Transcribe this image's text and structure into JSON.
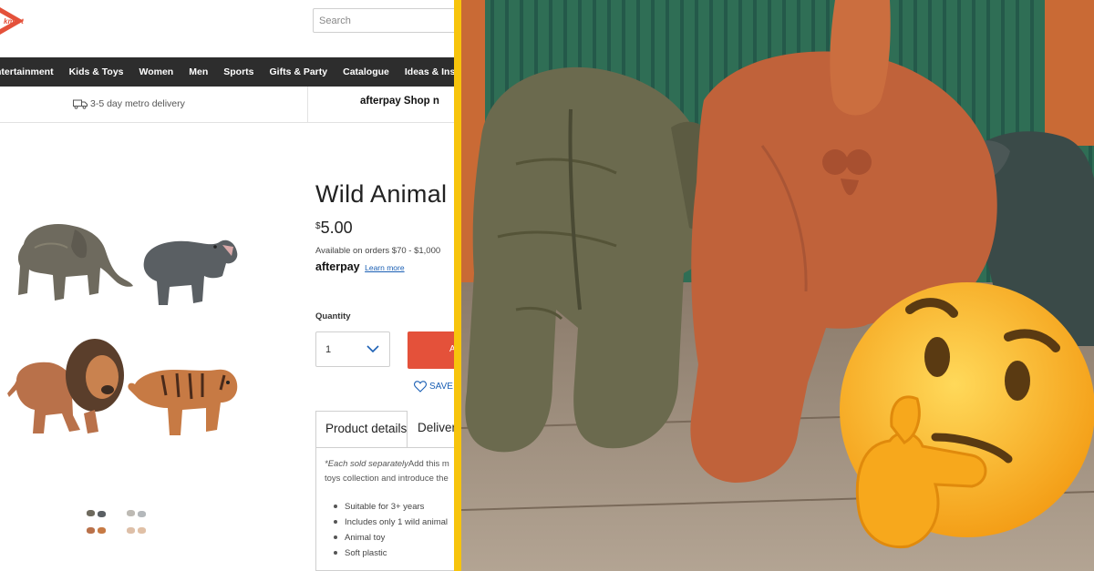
{
  "site": {
    "logo_text": "kmart",
    "search_placeholder": "Search",
    "nav": [
      "Entertainment",
      "Kids & Toys",
      "Women",
      "Men",
      "Sports",
      "Gifts & Party",
      "Catalogue",
      "Ideas & Inspiration"
    ],
    "delivery_label": "3-5 day metro delivery",
    "afterpay_banner": "afterpay Shop n"
  },
  "product": {
    "title": "Wild Animal",
    "price_symbol": "$",
    "price": "5.00",
    "availability": "Available on orders $70 - $1,000",
    "afterpay_brand": "afterpay",
    "afterpay_link": "Learn more",
    "quantity_label": "Quantity",
    "quantity_value": "1",
    "add_button_label": "A",
    "save_label": "SAVE F",
    "tabs": [
      "Product details",
      "Delivery"
    ],
    "description_italic": "*Each sold separately",
    "description_rest": "Add this m",
    "description_line2": "toys collection and introduce the",
    "features": [
      "Suitable for 3+ years",
      "Includes only 1 wild animal",
      "Animal toy",
      "Soft plastic"
    ]
  },
  "gallery": {
    "animals": [
      "elephant",
      "hippo",
      "lion",
      "tiger"
    ]
  },
  "colors": {
    "brand_red": "#e4513a",
    "nav_bg": "#2d2d2d",
    "divider_yellow": "#f7c40c",
    "link_blue": "#1a5fb4",
    "elephant": "#6e6a5e",
    "hippo": "#5a5f63",
    "lion": "#b9714a",
    "tiger": "#c77a44",
    "emoji_yellow": "#f9b31b"
  },
  "icons": [
    "truck-icon",
    "chevron-down-icon",
    "heart-icon",
    "thinking-face-emoji"
  ]
}
